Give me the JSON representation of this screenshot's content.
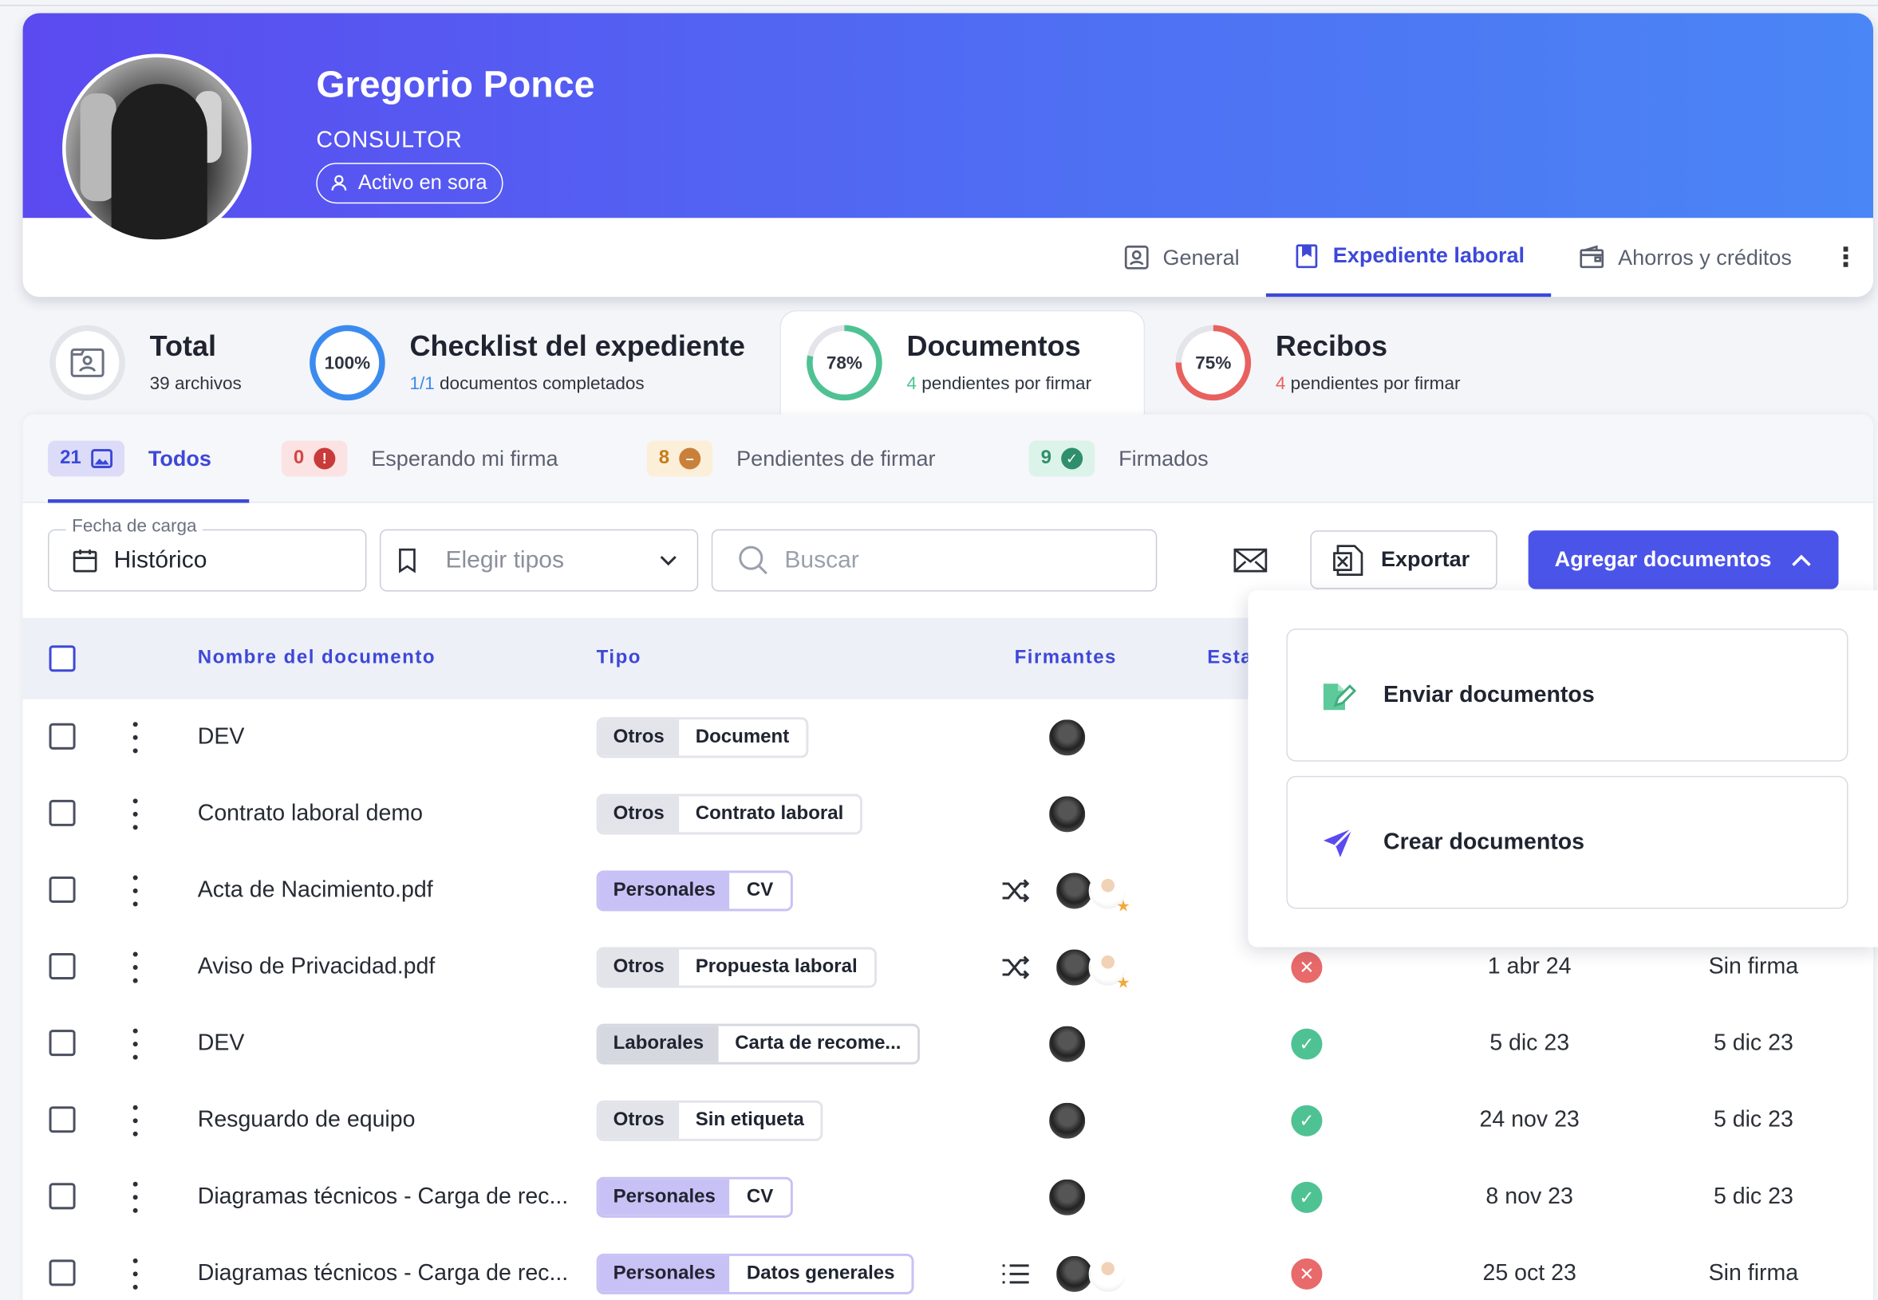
{
  "profile": {
    "name": "Gregorio Ponce",
    "role": "CONSULTOR",
    "status": "Activo en sora",
    "tabs": [
      "General",
      "Expediente laboral",
      "Ahorros y créditos"
    ]
  },
  "summary": {
    "total": {
      "title": "Total",
      "sub": "39 archivos"
    },
    "checklist": {
      "title": "Checklist del expediente",
      "pct": "100%",
      "ratio": "1/1",
      "sub": "documentos completados",
      "progress": 1.0,
      "color": "#3b8bef"
    },
    "documentos": {
      "title": "Documentos",
      "pct": "78%",
      "count": "4",
      "sub": "pendientes por firmar",
      "progress": 0.78,
      "color": "#4fc294"
    },
    "recibos": {
      "title": "Recibos",
      "pct": "75%",
      "count": "4",
      "sub": "pendientes por firmar",
      "progress": 0.75,
      "color": "#e8615f"
    }
  },
  "filters": [
    {
      "count": "21",
      "label": "Todos"
    },
    {
      "count": "0",
      "label": "Esperando mi firma"
    },
    {
      "count": "8",
      "label": "Pendientes de firmar"
    },
    {
      "count": "9",
      "label": "Firmados"
    }
  ],
  "toolbar": {
    "date_label": "Fecha de carga",
    "date_value": "Histórico",
    "types_placeholder": "Elegir tipos",
    "search_placeholder": "Buscar",
    "export_label": "Exportar",
    "add_label": "Agregar documentos"
  },
  "table": {
    "headers": {
      "name": "Nombre del documento",
      "type": "Tipo",
      "signers": "Firmantes",
      "status": "Esta"
    },
    "rows": [
      {
        "name": "DEV",
        "cat": "Otros",
        "tag": "Document"
      },
      {
        "name": "Contrato laboral demo",
        "cat": "Otros",
        "tag": "Contrato laboral"
      },
      {
        "name": "Acta de Nacimiento.pdf",
        "cat": "Personales",
        "tag": "CV"
      },
      {
        "name": "Aviso de Privacidad.pdf",
        "cat": "Otros",
        "tag": "Propuesta laboral",
        "date1": "1 abr 24",
        "date2": "Sin firma"
      },
      {
        "name": "DEV",
        "cat": "Laborales",
        "tag": "Carta de recome...",
        "date1": "5 dic 23",
        "date2": "5 dic 23"
      },
      {
        "name": "Resguardo de equipo",
        "cat": "Otros",
        "tag": "Sin etiqueta",
        "date1": "24 nov 23",
        "date2": "5 dic 23"
      },
      {
        "name": "Diagramas técnicos - Carga de rec...",
        "cat": "Personales",
        "tag": "CV",
        "date1": "8 nov 23",
        "date2": "5 dic 23"
      },
      {
        "name": "Diagramas técnicos - Carga de rec...",
        "cat": "Personales",
        "tag": "Datos generales",
        "date1": "25 oct 23",
        "date2": "Sin firma"
      }
    ]
  },
  "dropdown": {
    "send": "Enviar documentos",
    "create": "Crear documentos"
  }
}
